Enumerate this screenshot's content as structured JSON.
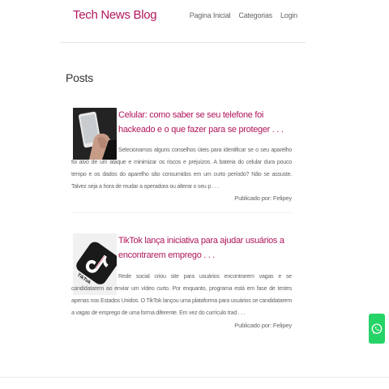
{
  "header": {
    "brand": "Tech News Blog",
    "nav": [
      "Pagina Inicial",
      "Categorias",
      "Login"
    ]
  },
  "main": {
    "section_title": "Posts",
    "posts": [
      {
        "title": "Celular: como saber se seu telefone foi hackeado e o que fazer para se proteger . . .",
        "excerpt": "Selecionamos alguns conselhos úteis para identificar se o seu aparelho foi alvo de um ataque e minimizar os riscos e prejuízos. A bateria do celular dura pouco tempo e os dados do aparelho são consumidos em um curto período? Não se assuste. Talvez seja a hora de mudar a operadora ou alterar o seu p . . .",
        "author": "Publicado por: Felipey",
        "image": "hand-holding-phone-photo"
      },
      {
        "title": "TikTok lança iniciativa para ajudar usuários a encontrarem emprego . . .",
        "excerpt": "Rede social criou site para usuários encontrarem vagas e se candidatarem ao enviar um vídeo curto. Por enquanto, programa está em fase de testes apenas nos Estados Unidos. O TikTok lançou uma plataforma para usuários se candidatarem a vagas de emprego de uma forma diferente. Em vez do currículo trad . . .",
        "author": "Publicado por: Felipey",
        "image": "tiktok-logo-photo"
      }
    ]
  },
  "floating": {
    "whatsapp_icon": "whatsapp-icon"
  },
  "colors": {
    "accent": "#b0175d",
    "whatsapp": "#25d366"
  }
}
